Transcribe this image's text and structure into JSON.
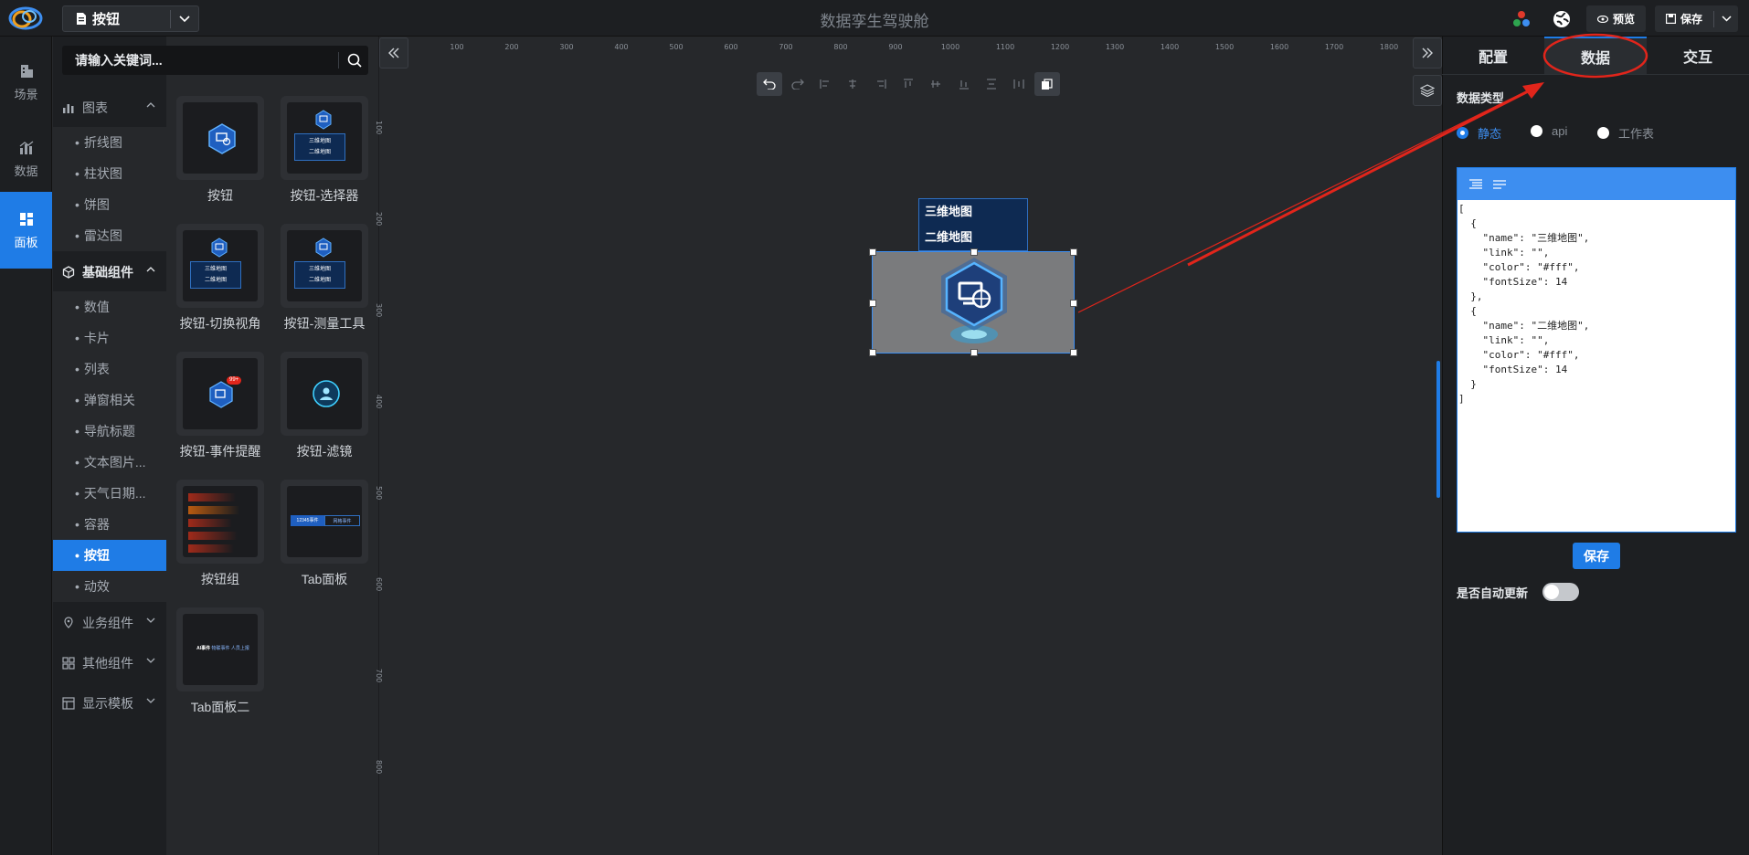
{
  "topbar": {
    "file_name": "按钮",
    "app_title": "数据孪生驾驶舱",
    "preview_label": "预览",
    "save_label": "保存"
  },
  "leftnav": [
    {
      "label": "场景",
      "icon": "building-icon"
    },
    {
      "label": "数据",
      "icon": "bar-chart-icon"
    },
    {
      "label": "面板",
      "icon": "dashboard-icon",
      "active": true
    }
  ],
  "search": {
    "placeholder": "请输入关键词..."
  },
  "tree": {
    "charts": {
      "label": "图表",
      "items": [
        "折线图",
        "柱状图",
        "饼图",
        "雷达图"
      ]
    },
    "basic": {
      "label": "基础组件",
      "items": [
        "数值",
        "卡片",
        "列表",
        "弹窗相关",
        "导航标题",
        "文本图片...",
        "天气日期...",
        "容器",
        "按钮",
        "动效"
      ],
      "active_index": 8
    },
    "business": {
      "label": "业务组件"
    },
    "other": {
      "label": "其他组件"
    },
    "templates": {
      "label": "显示模板"
    }
  },
  "gallery": [
    {
      "name": "按钮"
    },
    {
      "name": "按钮-选择器",
      "lines": [
        "三维地图",
        "二维地图"
      ]
    },
    {
      "name": "按钮-切换视角",
      "lines": [
        "三维地图",
        "二维地图"
      ]
    },
    {
      "name": "按钮-测量工具",
      "lines": [
        "三维地图",
        "二维地图"
      ]
    },
    {
      "name": "按钮-事件提醒",
      "badge": "99+"
    },
    {
      "name": "按钮-滤镜"
    },
    {
      "name": "按钮组"
    },
    {
      "name": "Tab面板",
      "tabs": [
        "12345事件",
        "网格事件"
      ]
    },
    {
      "name": "Tab面板二",
      "tabs": [
        "AI事件",
        "物联事件",
        "人员上报"
      ]
    }
  ],
  "ruler": {
    "h": [
      "100",
      "200",
      "300",
      "400",
      "500",
      "600",
      "700",
      "800",
      "900",
      "1000",
      "1100",
      "1200",
      "1300",
      "1400",
      "1500",
      "1600",
      "1700",
      "1800"
    ],
    "v": [
      "100",
      "200",
      "300",
      "400",
      "500",
      "600",
      "700",
      "800"
    ]
  },
  "canvas": {
    "menu_items": [
      "三维地图",
      "二维地图"
    ]
  },
  "panel": {
    "tabs": [
      "配置",
      "数据",
      "交互"
    ],
    "active_tab": 1,
    "data_type_label": "数据类型",
    "data_types": [
      "静态",
      "api",
      "工作表"
    ],
    "json_text": "[\n  {\n    \"name\": \"三维地图\",\n    \"link\": \"\",\n    \"color\": \"#fff\",\n    \"fontSize\": 14\n  },\n  {\n    \"name\": \"二维地图\",\n    \"link\": \"\",\n    \"color\": \"#fff\",\n    \"fontSize\": 14\n  }\n]",
    "save_label": "保存",
    "auto_update_label": "是否自动更新"
  },
  "colors": {
    "accent": "#1f7ce6",
    "annotation": "#e1251b"
  }
}
